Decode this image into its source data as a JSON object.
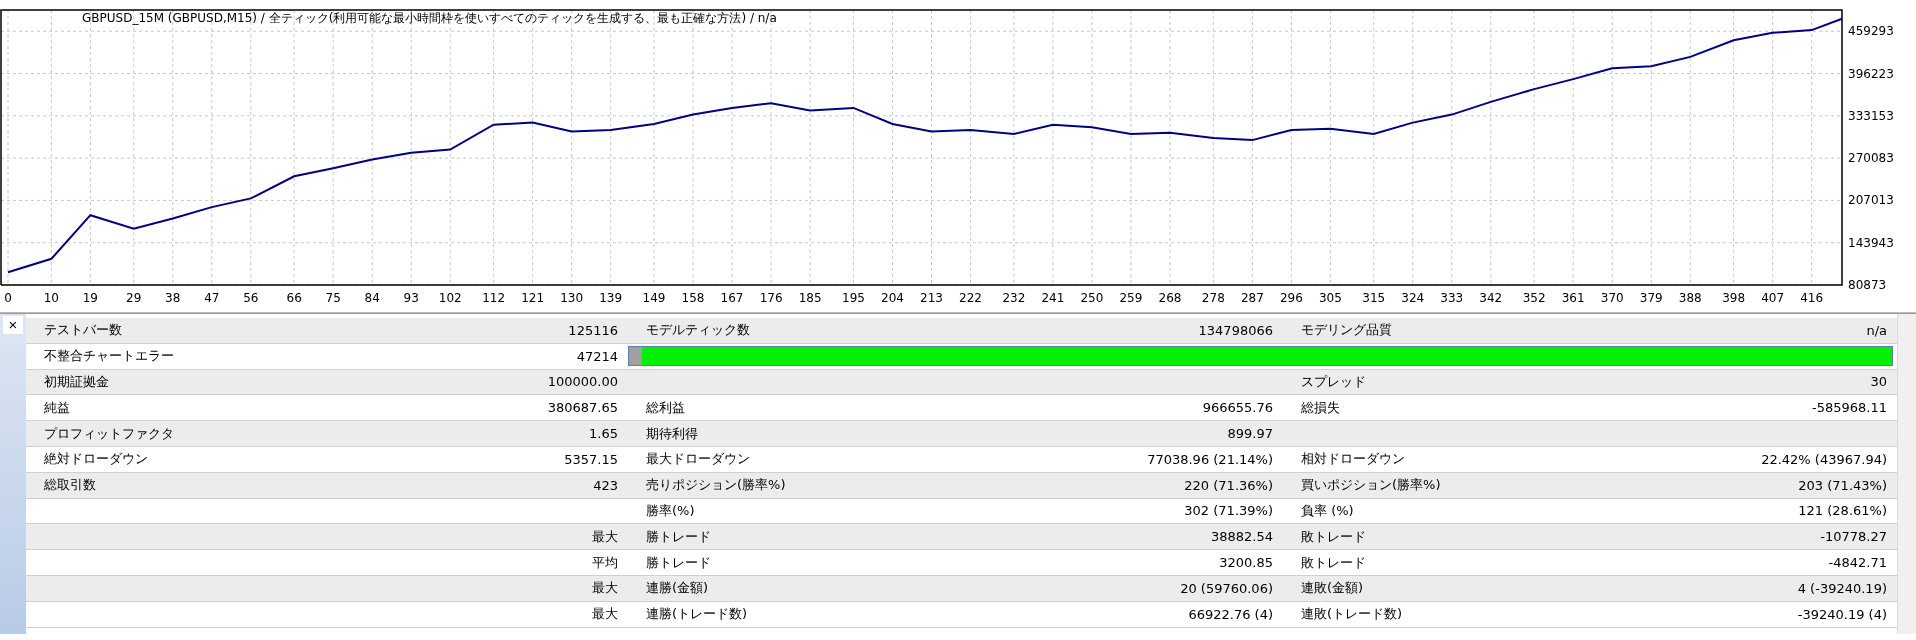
{
  "chart": {
    "title": "GBPUSD_15M (GBPUSD,M15) / 全ティック(利用可能な最小時間枠を使いすべてのティックを生成する、最も正確な方法) / n/a",
    "chart_data": {
      "type": "line",
      "x": [
        0,
        10,
        19,
        29,
        38,
        47,
        56,
        66,
        75,
        84,
        93,
        102,
        112,
        121,
        130,
        139,
        149,
        158,
        167,
        176,
        185,
        195,
        204,
        213,
        222,
        232,
        241,
        250,
        259,
        268,
        278,
        287,
        296,
        305,
        315,
        324,
        333,
        342,
        352,
        361,
        370,
        379,
        388,
        398,
        407,
        416,
        423
      ],
      "grid": true,
      "series": [
        {
          "color": "#000080",
          "values": [
            100000,
            120000,
            185000,
            165000,
            180000,
            197000,
            210000,
            243000,
            255000,
            268000,
            278000,
            283000,
            320000,
            323000,
            310000,
            312000,
            321000,
            335000,
            345000,
            352000,
            341000,
            345000,
            321000,
            310000,
            312000,
            306000,
            320000,
            316000,
            306000,
            308000,
            300000,
            297000,
            312000,
            314000,
            306000,
            323000,
            335000,
            354000,
            373000,
            388000,
            404000,
            407000,
            421000,
            446000,
            457000,
            461000,
            478000
          ]
        }
      ],
      "xlim": [
        0,
        423
      ],
      "ylim": [
        80873,
        491000
      ],
      "xticks": [
        0,
        10,
        19,
        29,
        38,
        47,
        56,
        66,
        75,
        84,
        93,
        102,
        112,
        121,
        130,
        139,
        149,
        158,
        167,
        176,
        185,
        195,
        204,
        213,
        222,
        232,
        241,
        250,
        259,
        268,
        278,
        287,
        296,
        305,
        315,
        324,
        333,
        342,
        352,
        361,
        370,
        379,
        388,
        398,
        407,
        416
      ],
      "yticks": [
        80873,
        143943,
        207013,
        270083,
        333153,
        396223,
        459293
      ]
    }
  },
  "close_button": "×",
  "report": {
    "rows": [
      {
        "kind": "text",
        "label_1": "テストバー数",
        "value_1": "125116",
        "label_2": "モデルティック数",
        "value_2": "134798066",
        "label_3": "モデリング品質",
        "value_3": "n/a"
      },
      {
        "kind": "bar",
        "label_1": "不整合チャートエラー",
        "value_1": "47214",
        "level": 0.99
      },
      {
        "kind": "text",
        "label_1": "初期証拠金",
        "value_1": "100000.00",
        "label_3": "スプレッド",
        "value_3": "30"
      },
      {
        "kind": "text",
        "label_1": "純益",
        "value_1": "380687.65",
        "label_2": "総利益",
        "value_2": "966655.76",
        "label_3": "総損失",
        "value_3": "-585968.11"
      },
      {
        "kind": "text",
        "label_1": "プロフィットファクタ",
        "value_1": "1.65",
        "label_2": "期待利得",
        "value_2": "899.97"
      },
      {
        "kind": "text",
        "label_1": "絶対ドローダウン",
        "value_1": "5357.15",
        "label_2": "最大ドローダウン",
        "value_2": "77038.96 (21.14%)",
        "label_3": "相対ドローダウン",
        "value_3": "22.42% (43967.94)"
      },
      {
        "kind": "text",
        "label_1": "総取引数",
        "value_1": "423",
        "label_2": "売りポジション(勝率%)",
        "value_2": "220 (71.36%)",
        "label_3": "買いポジション(勝率%)",
        "value_3": "203 (71.43%)"
      },
      {
        "kind": "text",
        "label_2": "勝率(%)",
        "value_2": "302 (71.39%)",
        "label_3": "負率 (%)",
        "value_3": "121 (28.61%)"
      },
      {
        "kind": "text",
        "value_1": "最大",
        "label_2": "勝トレード",
        "value_2": "38882.54",
        "label_3": "敗トレード",
        "value_3": "-10778.27"
      },
      {
        "kind": "text",
        "value_1": "平均",
        "label_2": "勝トレード",
        "value_2": "3200.85",
        "label_3": "敗トレード",
        "value_3": "-4842.71"
      },
      {
        "kind": "text",
        "value_1": "最大",
        "label_2": "連勝(金額)",
        "value_2": "20 (59760.06)",
        "label_3": "連敗(金額)",
        "value_3": "4 (-39240.19)"
      },
      {
        "kind": "text",
        "value_1": "最大",
        "label_2": "連勝(トレード数)",
        "value_2": "66922.76 (4)",
        "label_3": "連敗(トレード数)",
        "value_3": "-39240.19 (4)"
      }
    ]
  }
}
